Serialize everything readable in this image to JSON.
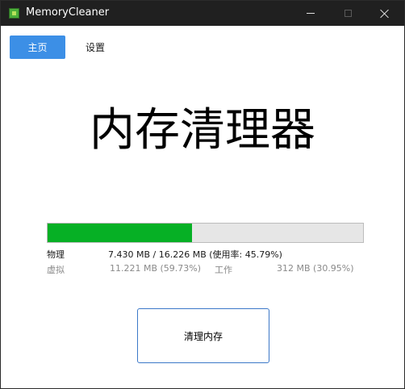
{
  "window": {
    "title": "MemoryCleaner",
    "icon": "memory-chip-icon"
  },
  "tabs": {
    "home": "主页",
    "settings": "设置"
  },
  "main": {
    "heading": "内存清理器",
    "progress_fraction": 0.4579,
    "progress_color": "#06b025",
    "stats": {
      "physical_label": "物理",
      "physical_value": "7.430 MB / 16.226 MB (使用率: 45.79%)",
      "virtual_label": "虚拟",
      "virtual_value": "11.221 MB (59.73%)",
      "working_label": "工作",
      "working_value": "312 MB (30.95%)"
    },
    "clean_button": "清理内存"
  },
  "colors": {
    "accent": "#3c8fe6",
    "titlebar": "#202020"
  }
}
